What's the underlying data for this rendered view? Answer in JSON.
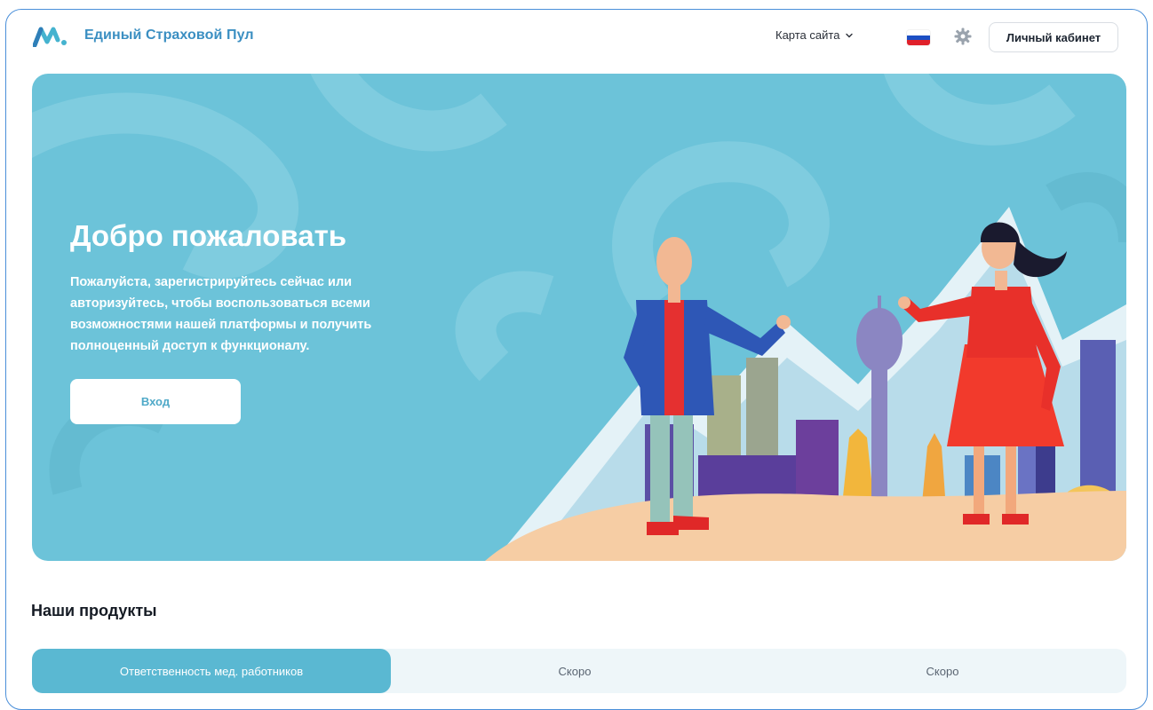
{
  "header": {
    "brand": "Единый Страховой Пул",
    "sitemap_label": "Карта сайта",
    "cabinet_label": "Личный кабинет",
    "flag_colors": [
      "#ffffff",
      "#1c4fc4",
      "#e0202a"
    ]
  },
  "hero": {
    "title": "Добро пожаловать",
    "text": "Пожалуйста, зарегистрируйтесь сейчас или авторизуйтесь, чтобы воспользоваться всеми возможностями нашей платформы и получить полноценный доступ к функционалу.",
    "login_label": "Вход"
  },
  "products": {
    "title": "Наши продукты",
    "tabs": [
      {
        "label": "Ответственность мед. работников",
        "active": true
      },
      {
        "label": "Скоро",
        "active": false
      },
      {
        "label": "Скоро",
        "active": false
      }
    ]
  },
  "colors": {
    "brand": "#3b8fc2",
    "hero_bg": "#6cc3d9",
    "tab_active": "#5ab8d2"
  },
  "icons": [
    "logo-icon",
    "chevron-down-icon",
    "russian-flag-icon",
    "accessibility-gear-icon"
  ]
}
